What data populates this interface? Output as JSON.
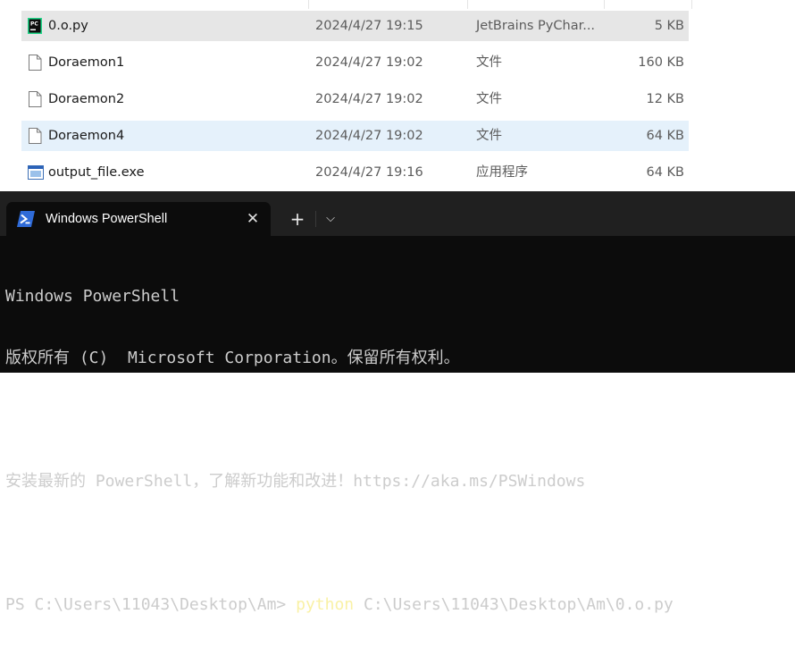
{
  "explorer": {
    "files": [
      {
        "name": "0.o.py",
        "date": "2024/4/27 19:15",
        "type": "JetBrains PyChar...",
        "size": "5 KB",
        "icon": "pycharm-file-icon",
        "state": "selected"
      },
      {
        "name": "Doraemon1",
        "date": "2024/4/27 19:02",
        "type": "文件",
        "size": "160 KB",
        "icon": "file-icon",
        "state": "normal"
      },
      {
        "name": "Doraemon2",
        "date": "2024/4/27 19:02",
        "type": "文件",
        "size": "12 KB",
        "icon": "file-icon",
        "state": "normal"
      },
      {
        "name": "Doraemon4",
        "date": "2024/4/27 19:02",
        "type": "文件",
        "size": "64 KB",
        "icon": "file-icon",
        "state": "hover"
      },
      {
        "name": "output_file.exe",
        "date": "2024/4/27 19:16",
        "type": "应用程序",
        "size": "64 KB",
        "icon": "exe-file-icon",
        "state": "normal"
      }
    ]
  },
  "terminal": {
    "tab_title": "Windows PowerShell",
    "tab_icon": "powershell-icon",
    "close_symbol": "✕",
    "new_tab_symbol": "+",
    "dropdown_symbol": "⌵",
    "lines": {
      "l1": "Windows PowerShell",
      "l2": "版权所有 (C)  Microsoft Corporation。保留所有权利。",
      "l3": "",
      "l4": "安装最新的 PowerShell，了解新功能和改进！https://aka.ms/PSWindows",
      "l5": "",
      "prompt": "PS C:\\Users\\11043\\Desktop\\Am> ",
      "command": "python",
      "args": " C:\\Users\\11043\\Desktop\\Am\\0.o.py"
    }
  },
  "colors": {
    "terminal_bg": "#0c0c0c",
    "tabbar_bg": "#202020",
    "command_yellow": "#f9f1a5",
    "selected_row": "#e6e6e6",
    "hover_row": "#e5f1fb"
  }
}
